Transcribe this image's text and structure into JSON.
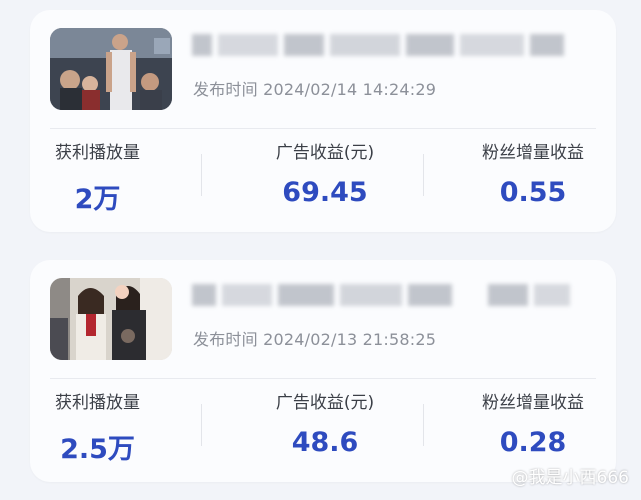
{
  "cards": [
    {
      "publish_label": "发布时间",
      "publish_time": "2024/02/14 14:24:29",
      "stats": [
        {
          "label": "获利播放量",
          "value": "2万"
        },
        {
          "label": "广告收益(元)",
          "value": "69.45"
        },
        {
          "label": "粉丝增量收益",
          "value": "0.55"
        }
      ]
    },
    {
      "publish_label": "发布时间",
      "publish_time": "2024/02/13 21:58:25",
      "stats": [
        {
          "label": "获利播放量",
          "value": "2.5万"
        },
        {
          "label": "广告收益(元)",
          "value": "48.6"
        },
        {
          "label": "粉丝增量收益",
          "value": "0.28"
        }
      ]
    }
  ],
  "watermark": "@我是小西666",
  "colors": {
    "accent": "#2e4bbf",
    "background": "#f2f4f9",
    "card": "#fbfcfe"
  }
}
